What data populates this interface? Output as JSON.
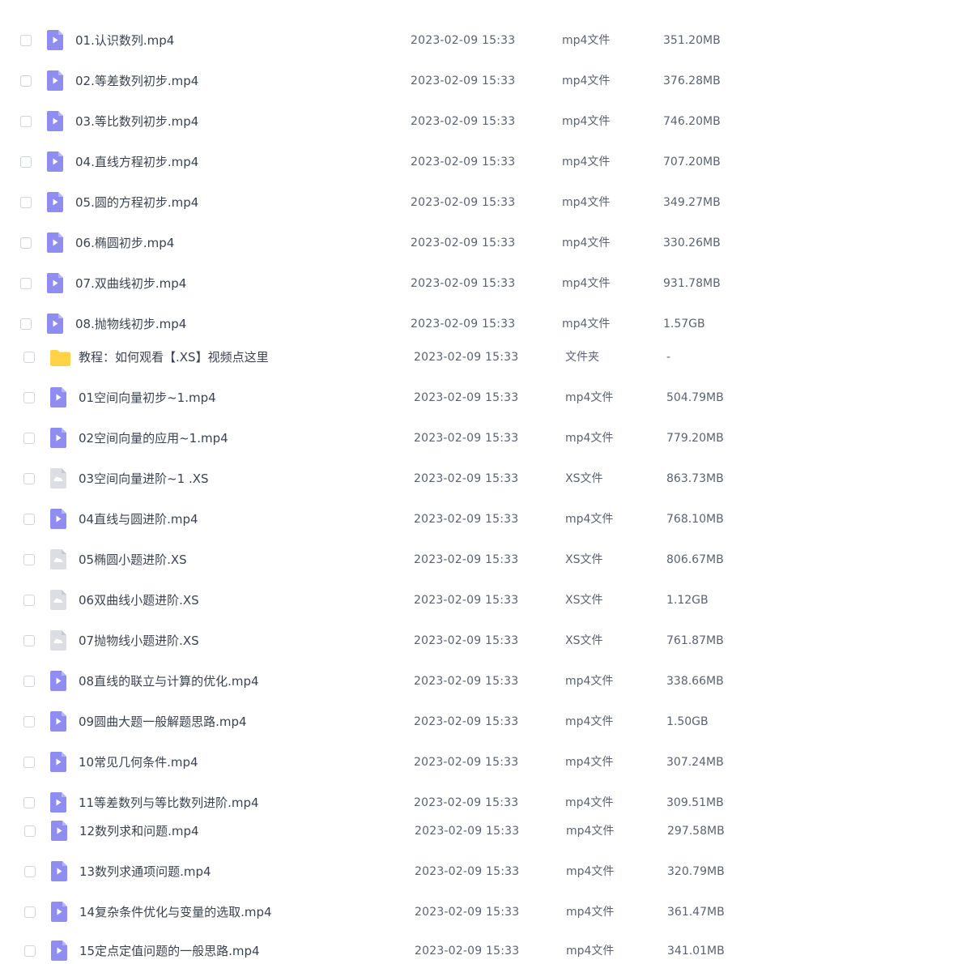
{
  "files": [
    {
      "name": "01.认识数列.mp4",
      "modified": "2023-02-09 15:33",
      "type": "mp4文件",
      "size": "351.20MB",
      "icon": "video-file-icon"
    },
    {
      "name": "02.等差数列初步.mp4",
      "modified": "2023-02-09 15:33",
      "type": "mp4文件",
      "size": "376.28MB",
      "icon": "video-file-icon"
    },
    {
      "name": "03.等比数列初步.mp4",
      "modified": "2023-02-09 15:33",
      "type": "mp4文件",
      "size": "746.20MB",
      "icon": "video-file-icon"
    },
    {
      "name": "04.直线方程初步.mp4",
      "modified": "2023-02-09 15:33",
      "type": "mp4文件",
      "size": "707.20MB",
      "icon": "video-file-icon"
    },
    {
      "name": "05.圆的方程初步.mp4",
      "modified": "2023-02-09 15:33",
      "type": "mp4文件",
      "size": "349.27MB",
      "icon": "video-file-icon"
    },
    {
      "name": "06.椭圆初步.mp4",
      "modified": "2023-02-09 15:33",
      "type": "mp4文件",
      "size": "330.26MB",
      "icon": "video-file-icon"
    },
    {
      "name": "07.双曲线初步.mp4",
      "modified": "2023-02-09 15:33",
      "type": "mp4文件",
      "size": "931.78MB",
      "icon": "video-file-icon"
    },
    {
      "name": "08.抛物线初步.mp4",
      "modified": "2023-02-09 15:33",
      "type": "mp4文件",
      "size": "1.57GB",
      "icon": "video-file-icon"
    },
    {
      "name": "教程：如何观看【.XS】视频点这里",
      "modified": "2023-02-09 15:33",
      "type": "文件夹",
      "size": "-",
      "icon": "folder-icon"
    },
    {
      "name": "01空间向量初步~1.mp4",
      "modified": "2023-02-09 15:33",
      "type": "mp4文件",
      "size": "504.79MB",
      "icon": "video-file-icon"
    },
    {
      "name": "02空间向量的应用~1.mp4",
      "modified": "2023-02-09 15:33",
      "type": "mp4文件",
      "size": "779.20MB",
      "icon": "video-file-icon"
    },
    {
      "name": "03空间向量进阶~1 .XS",
      "modified": "2023-02-09 15:33",
      "type": "XS文件",
      "size": "863.73MB",
      "icon": "unknown-file-icon"
    },
    {
      "name": "04直线与圆进阶.mp4",
      "modified": "2023-02-09 15:33",
      "type": "mp4文件",
      "size": "768.10MB",
      "icon": "video-file-icon"
    },
    {
      "name": "05椭圆小题进阶.XS",
      "modified": "2023-02-09 15:33",
      "type": "XS文件",
      "size": "806.67MB",
      "icon": "unknown-file-icon"
    },
    {
      "name": "06双曲线小题进阶.XS",
      "modified": "2023-02-09 15:33",
      "type": "XS文件",
      "size": "1.12GB",
      "icon": "unknown-file-icon"
    },
    {
      "name": "07抛物线小题进阶.XS",
      "modified": "2023-02-09 15:33",
      "type": "XS文件",
      "size": "761.87MB",
      "icon": "unknown-file-icon"
    },
    {
      "name": "08直线的联立与计算的优化.mp4",
      "modified": "2023-02-09 15:33",
      "type": "mp4文件",
      "size": "338.66MB",
      "icon": "video-file-icon"
    },
    {
      "name": "09圆曲大题一般解题思路.mp4",
      "modified": "2023-02-09 15:33",
      "type": "mp4文件",
      "size": "1.50GB",
      "icon": "video-file-icon"
    },
    {
      "name": "10常见几何条件.mp4",
      "modified": "2023-02-09 15:33",
      "type": "mp4文件",
      "size": "307.24MB",
      "icon": "video-file-icon"
    },
    {
      "name": "11等差数列与等比数列进阶.mp4",
      "modified": "2023-02-09 15:33",
      "type": "mp4文件",
      "size": "309.51MB",
      "icon": "video-file-icon"
    },
    {
      "name": "12数列求和问题.mp4",
      "modified": "2023-02-09 15:33",
      "type": "mp4文件",
      "size": "297.58MB",
      "icon": "video-file-icon"
    },
    {
      "name": "13数列求通项问题.mp4",
      "modified": "2023-02-09 15:33",
      "type": "mp4文件",
      "size": "320.79MB",
      "icon": "video-file-icon"
    },
    {
      "name": "14复杂条件优化与变量的选取.mp4",
      "modified": "2023-02-09 15:33",
      "type": "mp4文件",
      "size": "361.47MB",
      "icon": "video-file-icon"
    },
    {
      "name": "15定点定值问题的一般思路.mp4",
      "modified": "2023-02-09 15:33",
      "type": "mp4文件",
      "size": "341.01MB",
      "icon": "video-file-icon"
    }
  ],
  "colors": {
    "video_icon": "#8f8df0",
    "folder_icon": "#ffd247",
    "unknown_icon": "#dcdee3"
  }
}
